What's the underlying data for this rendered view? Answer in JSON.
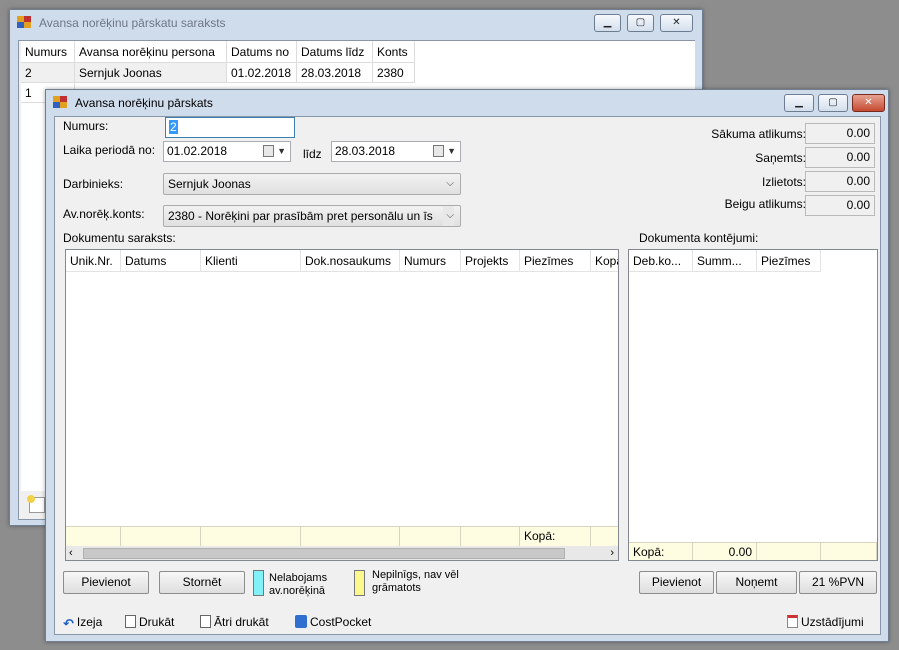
{
  "back_window": {
    "title": "Avansa norēķinu pārskatu saraksts",
    "controls": {
      "min": "▁",
      "max": "▢",
      "close": "✕"
    },
    "columns": [
      "Numurs",
      "Avansa norēķinu persona",
      "Datums no",
      "Datums līdz",
      "Konts"
    ],
    "rows": [
      [
        "2",
        "Sernjuk Joonas",
        "01.02.2018",
        "28.03.2018",
        "2380"
      ],
      [
        "1",
        "",
        "",
        "",
        ""
      ]
    ]
  },
  "front_window": {
    "title": "Avansa norēķinu pārskats",
    "controls": {
      "min": "▁",
      "max": "▢",
      "close": "✕"
    },
    "numurs_label": "Numurs:",
    "numurs_value": "2",
    "period_label": "Laika periodā no:",
    "date_from": "01.02.2018",
    "lidz_label": "līdz",
    "date_to": "28.03.2018",
    "darbinieks_label": "Darbinieks:",
    "darbinieks_value": "Sernjuk Joonas",
    "konts_label": "Av.norēķ.konts:",
    "konts_value": "2380 - Norēķini par prasībām pret personālu un īs",
    "summary": [
      {
        "label": "Sākuma atlikums:",
        "value": "0.00"
      },
      {
        "label": "Saņemts:",
        "value": "0.00"
      },
      {
        "label": "Izlietots:",
        "value": "0.00"
      },
      {
        "label": "Beigu atlikums:",
        "value": "0.00"
      }
    ],
    "docs_title": "Dokumentu saraksts:",
    "docs_columns": [
      "Unik.Nr.",
      "Datums",
      "Klienti",
      "Dok.nosaukums",
      "Numurs",
      "Projekts",
      "Piezīmes",
      "Kopā"
    ],
    "docs_total_label": "Kopā:",
    "kont_title": "Dokumenta kontējumi:",
    "kont_columns": [
      "Deb.ko...",
      "Summ...",
      "Piezīmes"
    ],
    "kont_total_label": "Kopā:",
    "kont_total_value": "0.00",
    "buttons": {
      "add_left": "Pievienot",
      "storno": "Stornēt",
      "add_right": "Pievienot",
      "remove": "Noņemt",
      "vat": "21 %PVN"
    },
    "legend": [
      {
        "text": "Nelabojams av.norēķinā",
        "color": "#7ff1f7"
      },
      {
        "text": "Nepilnīgs, nav vēl grāmatots",
        "color": "#fbf88c"
      }
    ],
    "toolbar": {
      "exit": "Izeja",
      "print": "Drukāt",
      "quick_print": "Ātri drukāt",
      "costpocket": "CostPocket",
      "settings": "Uzstādījumi"
    }
  }
}
